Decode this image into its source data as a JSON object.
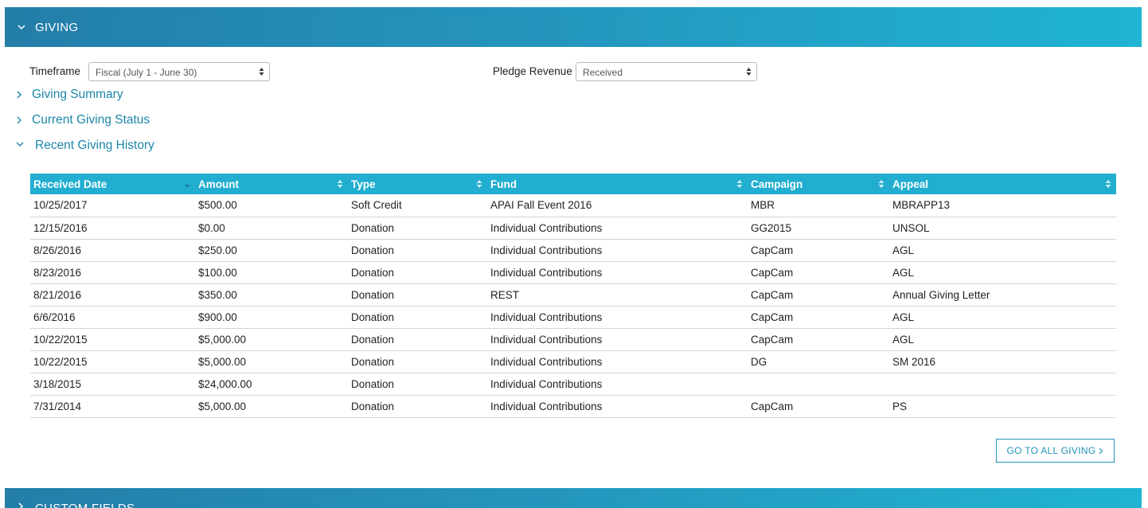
{
  "giving_section": {
    "title": "GIVING"
  },
  "filters": {
    "timeframe_label": "Timeframe",
    "timeframe_value": "Fiscal (July 1 - June 30)",
    "pledge_label": "Pledge Revenue",
    "pledge_value": "Received"
  },
  "accordions": [
    {
      "label": "Giving Summary",
      "expanded": false
    },
    {
      "label": "Current Giving Status",
      "expanded": false
    },
    {
      "label": "Recent Giving History",
      "expanded": true
    }
  ],
  "table": {
    "columns": [
      "Received Date",
      "Amount",
      "Type",
      "Fund",
      "Campaign",
      "Appeal"
    ],
    "rows": [
      [
        "10/25/2017",
        "$500.00",
        "Soft Credit",
        "APAI Fall Event 2016",
        "MBR",
        "MBRAPP13"
      ],
      [
        "12/15/2016",
        "$0.00",
        "Donation",
        "Individual Contributions",
        "GG2015",
        "UNSOL"
      ],
      [
        "8/26/2016",
        "$250.00",
        "Donation",
        "Individual Contributions",
        "CapCam",
        "AGL"
      ],
      [
        "8/23/2016",
        "$100.00",
        "Donation",
        "Individual Contributions",
        "CapCam",
        "AGL"
      ],
      [
        "8/21/2016",
        "$350.00",
        "Donation",
        "REST",
        "CapCam",
        "Annual Giving Letter"
      ],
      [
        "6/6/2016",
        "$900.00",
        "Donation",
        "Individual Contributions",
        "CapCam",
        "AGL"
      ],
      [
        "10/22/2015",
        "$5,000.00",
        "Donation",
        "Individual Contributions",
        "CapCam",
        "AGL"
      ],
      [
        "10/22/2015",
        "$5,000.00",
        "Donation",
        "Individual Contributions",
        "DG",
        "SM 2016"
      ],
      [
        "3/18/2015",
        "$24,000.00",
        "Donation",
        "Individual Contributions",
        "",
        ""
      ],
      [
        "7/31/2014",
        "$5,000.00",
        "Donation",
        "Individual Contributions",
        "CapCam",
        "PS"
      ]
    ]
  },
  "go_to_all_giving": "GO TO ALL GIVING",
  "custom_fields_section": {
    "title": "CUSTOM FIELDS"
  },
  "colors": {
    "header_start": "#237ea8",
    "header_end": "#20b4d2",
    "table_header": "#21aed0",
    "link": "#1d86a8"
  }
}
